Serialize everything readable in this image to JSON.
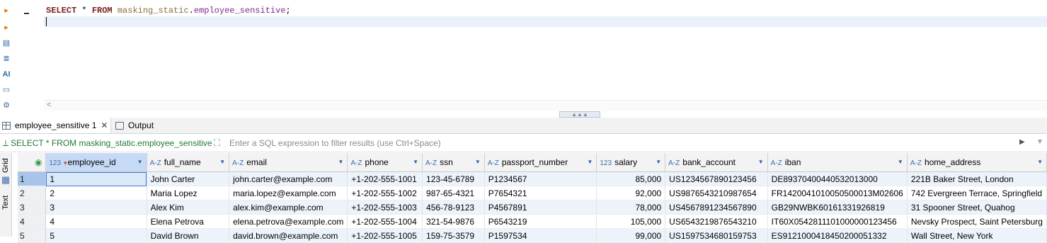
{
  "editor": {
    "keyword_select": "SELECT",
    "star": "*",
    "keyword_from": "FROM",
    "schema": "masking_static",
    "dot": ".",
    "table": "employee_sensitive",
    "semicolon": ";",
    "gutter_icons": [
      "execute-statement-icon",
      "execute-script-icon",
      "explain-plan-icon",
      "format-sql-icon",
      "ai-assistant-icon",
      "console-icon",
      "settings-icon"
    ],
    "ai_label": "AI",
    "scroll_left_glyph": "<"
  },
  "tabs": [
    {
      "label": "employee_sensitive 1",
      "active": true,
      "close": "✕"
    },
    {
      "label": "Output",
      "active": false
    }
  ],
  "filter": {
    "query_text": "SELECT * FROM masking_static.employee_sensitive",
    "placeholder": "Enter a SQL expression to filter results (use Ctrl+Space)"
  },
  "side_tabs": [
    "Grid",
    "Text"
  ],
  "grid": {
    "columns": [
      {
        "name": "employee_id",
        "type": "123"
      },
      {
        "name": "full_name",
        "type": "A-Z"
      },
      {
        "name": "email",
        "type": "A-Z"
      },
      {
        "name": "phone",
        "type": "A-Z"
      },
      {
        "name": "ssn",
        "type": "A-Z"
      },
      {
        "name": "passport_number",
        "type": "A-Z"
      },
      {
        "name": "salary",
        "type": "123"
      },
      {
        "name": "bank_account",
        "type": "A-Z"
      },
      {
        "name": "iban",
        "type": "A-Z"
      },
      {
        "name": "home_address",
        "type": "A-Z"
      }
    ],
    "rows": [
      [
        "1",
        "1",
        "John Carter",
        "john.carter@example.com",
        "+1-202-555-1001",
        "123-45-6789",
        "P1234567",
        "85,000",
        "US1234567890123456",
        "DE89370400440532013000",
        "221B Baker Street, London"
      ],
      [
        "2",
        "2",
        "Maria Lopez",
        "maria.lopez@example.com",
        "+1-202-555-1002",
        "987-65-4321",
        "P7654321",
        "92,000",
        "US9876543210987654",
        "FR1420041010050500013M02606",
        "742 Evergreen Terrace, Springfield"
      ],
      [
        "3",
        "3",
        "Alex Kim",
        "alex.kim@example.com",
        "+1-202-555-1003",
        "456-78-9123",
        "P4567891",
        "78,000",
        "US4567891234567890",
        "GB29NWBK60161331926819",
        "31 Spooner Street, Quahog"
      ],
      [
        "4",
        "4",
        "Elena Petrova",
        "elena.petrova@example.com",
        "+1-202-555-1004",
        "321-54-9876",
        "P6543219",
        "105,000",
        "US6543219876543210",
        "IT60X0542811101000000123456",
        "Nevsky Prospect, Saint Petersburg"
      ],
      [
        "5",
        "5",
        "David Brown",
        "david.brown@example.com",
        "+1-202-555-1005",
        "159-75-3579",
        "P1597534",
        "99,000",
        "US1597534680159753",
        "ES9121000418450200051332",
        "Wall Street, New York"
      ]
    ]
  }
}
